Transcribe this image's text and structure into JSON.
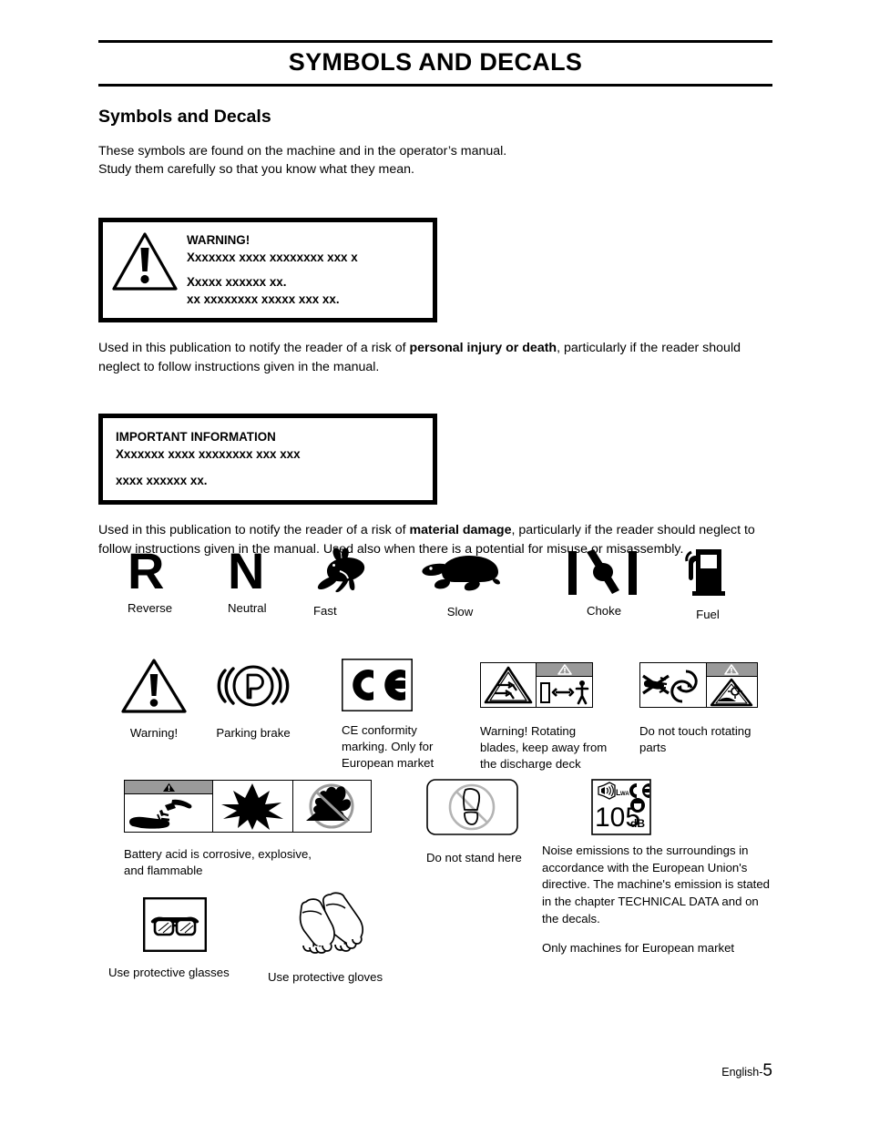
{
  "header": {
    "doc_title": "SYMBOLS AND DECALS",
    "section_title": "Symbols and Decals",
    "intro_line1": "These symbols are found on the machine and in the operator’s manual.",
    "intro_line2": "Study them carefully so that you know what they mean."
  },
  "warning_box": {
    "title": "WARNING!",
    "line1": "Xxxxxxx xxxx xxxxxxxx xxx x",
    "line2": "Xxxxx xxxxxx xx.",
    "line3": "xx xxxxxxxx xxxxx xxx xx.",
    "icon": "warning-triangle-icon"
  },
  "warning_para": {
    "pre": "Used in this publication to notify the reader of a risk of ",
    "bold": "personal injury or death",
    "post": ", particularly if the reader should neglect to follow instructions given in the manual."
  },
  "info_box": {
    "title": "IMPORTANT INFORMATION",
    "line1": "Xxxxxxx xxxx xxxxxxxx xxx xxx",
    "line2": "xxxx xxxxxx xx."
  },
  "info_para": {
    "pre": "Used in this publication to notify the reader of a risk of ",
    "bold": "material damage",
    "post": ", particularly if the reader should neglect to follow instructions given in the manual. Used also when there is a potential for misuse or misassembly."
  },
  "symbols_row1": [
    {
      "id": "reverse",
      "label": "Reverse",
      "glyph": "R",
      "icon": "letter-r-icon"
    },
    {
      "id": "neutral",
      "label": "Neutral",
      "glyph": "N",
      "icon": "letter-n-icon"
    },
    {
      "id": "fast",
      "label": "Fast",
      "icon": "rabbit-icon"
    },
    {
      "id": "slow",
      "label": "Slow",
      "icon": "turtle-icon"
    },
    {
      "id": "choke",
      "label": "Choke",
      "icon": "choke-valve-icon"
    },
    {
      "id": "fuel",
      "label": "Fuel",
      "icon": "fuel-pump-icon"
    }
  ],
  "symbols_row2": [
    {
      "id": "warning",
      "label": "Warning!",
      "icon": "warning-triangle-icon"
    },
    {
      "id": "parking-brake",
      "label": "Parking brake",
      "icon": "parking-brake-icon"
    },
    {
      "id": "ce-marking",
      "label": "CE conformity\nmarking. Only for\nEuropean market",
      "icon": "ce-mark-icon"
    },
    {
      "id": "rotating-blades",
      "label": "Warning! Rotating\nblades, keep away from\nthe discharge deck",
      "icon": "rotating-blades-decal"
    },
    {
      "id": "do-not-touch",
      "label": "Do not touch rotating\nparts",
      "icon": "do-not-touch-rotating-parts-decal"
    }
  ],
  "symbols_row3": [
    {
      "id": "battery-acid",
      "label": "Battery acid is corrosive, explosive,\nand flammable",
      "icon": "battery-acid-decal"
    },
    {
      "id": "do-not-stand",
      "label": "Do not stand here",
      "icon": "do-not-stand-here-icon"
    },
    {
      "id": "noise-level",
      "icon": "noise-level-decal",
      "value": "105",
      "unit": "dB",
      "lwa": "LwA"
    }
  ],
  "noise_text": {
    "paragraph1": "Noise emissions to the surroundings in accordance with the European Union's directive. The machine's emission is stated in the chapter TECHNICAL DATA and on the decals.",
    "paragraph2": "Only machines for European market"
  },
  "symbols_row4": [
    {
      "id": "protective-glasses",
      "label": "Use protective glasses",
      "icon": "safety-glasses-icon"
    },
    {
      "id": "protective-gloves",
      "label": "Use protective gloves",
      "icon": "safety-gloves-icon"
    }
  ],
  "footer": {
    "language": "English-",
    "page_number": "5"
  },
  "colors": {
    "ink": "#000000",
    "paper": "#ffffff",
    "decal_gray": "#9a9a9a",
    "light_gray": "#c8c8c8"
  }
}
